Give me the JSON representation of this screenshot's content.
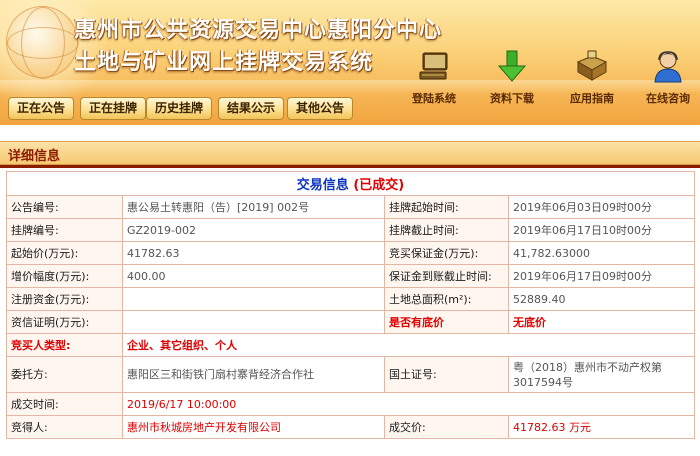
{
  "header": {
    "title_line1": "惠州市公共资源交易中心惠阳分中心",
    "title_line2": "土地与矿业网上挂牌交易系统",
    "tools": [
      {
        "label": "登陆系统",
        "icon": "computer-icon"
      },
      {
        "label": "资料下载",
        "icon": "download-arrow-icon"
      },
      {
        "label": "应用指南",
        "icon": "guide-book-icon"
      },
      {
        "label": "在线咨询",
        "icon": "support-agent-icon"
      }
    ]
  },
  "nav": [
    {
      "label": "正在公告"
    },
    {
      "label": "正在挂牌"
    },
    {
      "label": "历史挂牌"
    },
    {
      "label": "结果公示"
    },
    {
      "label": "其他公告"
    }
  ],
  "section_title": "详细信息",
  "detail": {
    "heading_main": "交易信息",
    "heading_status": "(已成交)",
    "rows": [
      {
        "l1": "公告编号:",
        "v1": "惠公易土转惠阳（告）[2019] 002号",
        "l2": "挂牌起始时间:",
        "v2": "2019年06月03日09时00分"
      },
      {
        "l1": "挂牌编号:",
        "v1": "GZ2019-002",
        "l2": "挂牌截止时间:",
        "v2": "2019年06月17日10时00分"
      },
      {
        "l1": "起始价(万元):",
        "v1": "41782.63",
        "l2": "竞买保证金(万元):",
        "v2": "41,782.63000"
      },
      {
        "l1": "增价幅度(万元):",
        "v1": "400.00",
        "l2": "保证金到账截止时间:",
        "v2": "2019年06月17日09时00分"
      },
      {
        "l1": "注册资金(万元):",
        "v1": "",
        "l2": "土地总面积(m²):",
        "v2": "52889.40"
      },
      {
        "l1": "资信证明(万元):",
        "v1": "",
        "l2": "是否有底价",
        "v2": "无底价"
      }
    ],
    "buyer_type_label": "竞买人类型:",
    "buyer_type_value": "企业、其它组织、个人",
    "entrust_label": "委托方:",
    "entrust_value": "惠阳区三和街铁门扇村寨背经济合作社",
    "land_cert_label": "国土证号:",
    "land_cert_value": "粤（2018）惠州市不动产权第3017594号",
    "deal_time_label": "成交时间:",
    "deal_time_value": "2019/6/17 10:00:00",
    "winner_label": "竞得人:",
    "winner_value": "惠州市秋城房地产开发有限公司",
    "deal_price_label": "成交价:",
    "deal_price_value": "41782.63 万元"
  }
}
